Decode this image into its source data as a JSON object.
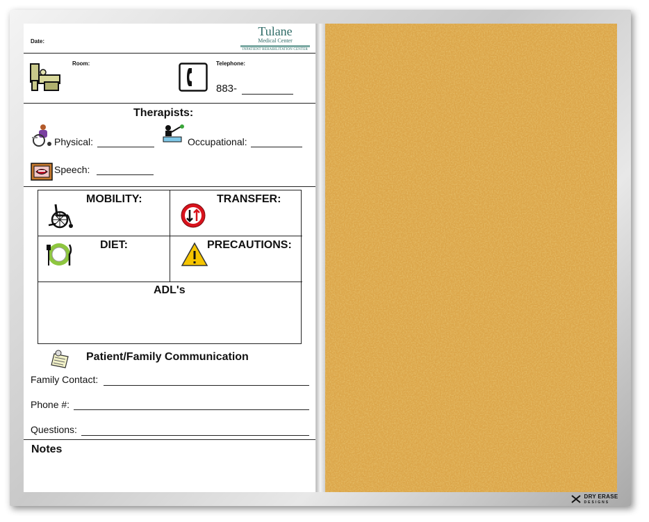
{
  "header": {
    "date_label": "Date:",
    "logo_name": "Tulane",
    "logo_sub": "Medical Center",
    "logo_tag": "INPATIENT REHABILITATION CENTER"
  },
  "room": {
    "room_label": "Room:",
    "telephone_label": "Telephone:",
    "phone_prefix": "883-"
  },
  "therapists": {
    "title": "Therapists:",
    "physical": "Physical:",
    "occupational": "Occupational:",
    "speech": "Speech:"
  },
  "grid": {
    "mobility": "MOBILITY:",
    "transfer": "TRANSFER:",
    "diet": "DIET:",
    "precautions": "PRECAUTIONS:",
    "adls": "ADL's"
  },
  "communication": {
    "title": "Patient/Family Communication",
    "family_contact": "Family Contact:",
    "phone": "Phone #:",
    "questions": "Questions:"
  },
  "notes": {
    "title": "Notes"
  },
  "brand": {
    "name": "DRY ERASE",
    "sub": "DESIGNS"
  },
  "colors": {
    "cork": "#d29a3a",
    "logo": "#2f6b67",
    "frame": "#c9c9c9"
  },
  "icons": [
    "hospital-bed-icon",
    "telephone-icon",
    "physical-therapy-icon",
    "occupational-therapy-icon",
    "speech-therapy-icon",
    "wheelchair-icon",
    "no-entry-arrows-icon",
    "plate-utensils-icon",
    "warning-triangle-icon",
    "notepad-icon"
  ]
}
